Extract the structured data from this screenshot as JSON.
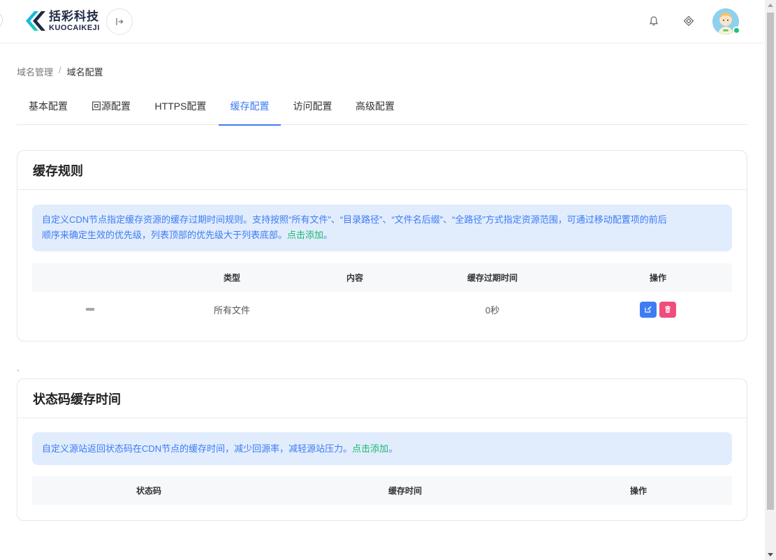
{
  "brand": {
    "name_cn": "括彩科技",
    "name_en": "KUOCAIKEJI",
    "colors": {
      "primary": "#3d7cf4",
      "link_green": "#19b96f",
      "danger": "#ef4d7d",
      "notice_bg": "#e1ecfd",
      "logo_gradient": [
        "#1aa7ff",
        "#17d6a0"
      ]
    }
  },
  "header": {
    "collapse_icon": "sidebar-collapse-icon",
    "notification_icon": "bell-icon",
    "settings_icon": "diamond-grid-icon",
    "user_avatar": "avatar",
    "online_status": "online"
  },
  "breadcrumb": {
    "items": [
      "域名管理",
      "域名配置"
    ],
    "separator": "/"
  },
  "tabs": {
    "items": [
      "基本配置",
      "回源配置",
      "HTTPS配置",
      "缓存配置",
      "访问配置",
      "高级配置"
    ],
    "active_index": 3
  },
  "cache_rules": {
    "title": "缓存规则",
    "notice_line1": "自定义CDN节点指定缓存资源的缓存过期时间规则。支持按照“所有文件”、“目录路径”、“文件名后缀”、“全路径”方式指定资源范围，可通过移动配置项的前后",
    "notice_line2": "顺序来确定生效的优先级，列表顶部的优先级大于列表底部。",
    "notice_link": "点击添加",
    "notice_end": "。",
    "columns": [
      "类型",
      "内容",
      "缓存过期时间",
      "操作"
    ],
    "rows": [
      {
        "type": "所有文件",
        "content": "",
        "expire": "0秒",
        "actions": [
          "edit-icon",
          "delete-icon"
        ]
      }
    ]
  },
  "status_code_cache": {
    "title": "状态码缓存时间",
    "notice_text": "自定义源站返回状态码在CDN节点的缓存时间，减少回源率，减轻源站压力。",
    "notice_link": "点击添加",
    "notice_end": "。",
    "columns": [
      "状态码",
      "缓存时间",
      "操作"
    ],
    "rows": []
  },
  "stray_mark": "`"
}
